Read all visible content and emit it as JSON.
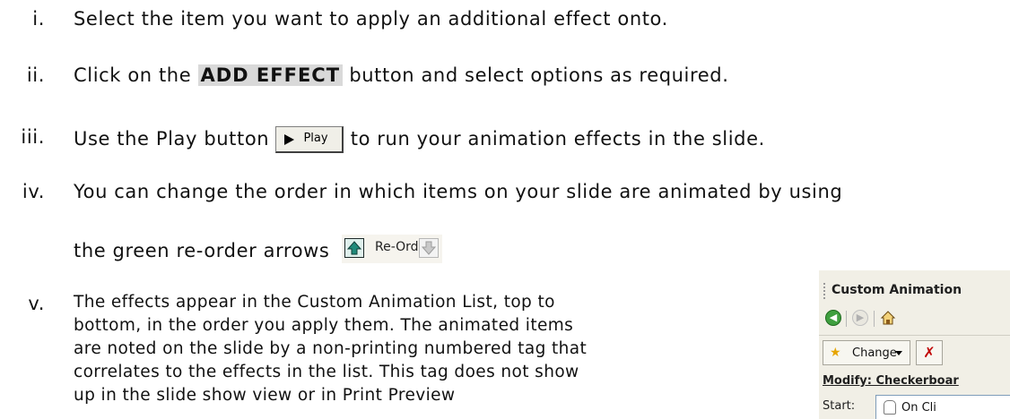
{
  "steps": [
    {
      "num": "i.",
      "text": "Select the item you want to apply an additional effect onto."
    },
    {
      "num": "ii.",
      "pre": "Click on the ",
      "bold": "ADD EFFECT",
      "post": " button and select options as required."
    },
    {
      "num": "iii.",
      "pre": "Use the Play button ",
      "button_label": "Play",
      "post": " to run your animation effects in the slide."
    },
    {
      "num": "iv.",
      "line1": "You can change the order in which items on your slide are animated by using",
      "line2": "the green re-order arrows",
      "reorder_label": "Re-Order"
    },
    {
      "num": "v.",
      "lines": [
        "The effects appear in the Custom Animation List, top to",
        "bottom, in the order you apply them. The animated items",
        "are noted on the slide by a non-printing numbered tag that",
        "correlates to the effects in the list. This tag does not show",
        "up in the slide show view or in Print Preview"
      ]
    }
  ],
  "panel": {
    "title": "Custom Animation",
    "change_label": "Change",
    "remove_glyph": "✗",
    "modify_label": "Modify: Checkerboar",
    "start_label": "Start:",
    "start_value": "On Cli"
  },
  "icons": {
    "play": "play-triangle-icon",
    "reorder_up": "arrow-up-icon",
    "reorder_down": "arrow-down-icon",
    "back": "back-arrow-icon",
    "forward": "forward-arrow-icon",
    "home": "home-icon",
    "change": "star-icon",
    "start": "mouse-icon"
  }
}
